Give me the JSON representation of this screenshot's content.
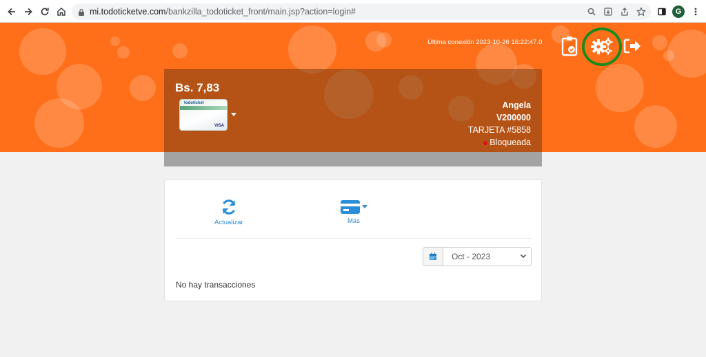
{
  "browser": {
    "url_host": "mi.todoticketve.com",
    "url_path": "/bankzilla_todoticket_front/main.jsp?action=login#",
    "profile_initial": "G"
  },
  "header": {
    "last_connection": "Última conexión 2023-10-26 16:22:47.0"
  },
  "card": {
    "balance": "Bs. 7,83",
    "brand": "todoticket",
    "network": "VISA",
    "holder_name": "Angela",
    "holder_id": "V200000",
    "card_number": "TARJETA #5858",
    "status": "Bloqueada"
  },
  "actions": {
    "refresh_label": "Actualizar",
    "more_label": "Más"
  },
  "filter": {
    "period": "Oct - 2023"
  },
  "transactions": {
    "empty_text": "No hay transacciones"
  },
  "colors": {
    "banner": "#ff6f1a",
    "accent_blue": "#2a8fd8",
    "highlight_ring": "#1c8a1c",
    "status_blocked": "#e01010"
  }
}
